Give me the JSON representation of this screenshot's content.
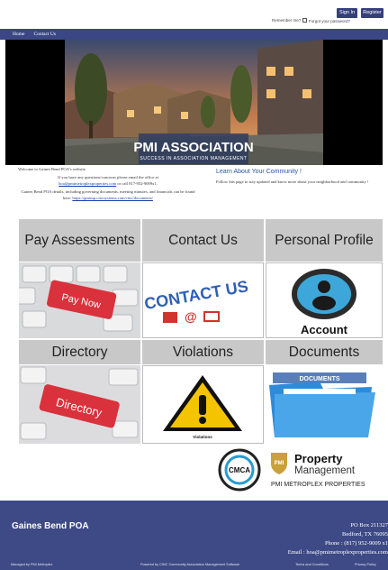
{
  "topbar": {
    "signin_label": "Sign In",
    "register_label": "Register",
    "remember_label": "Remember me?",
    "forgot_label": "Forgot your password?"
  },
  "nav": {
    "items": [
      {
        "label": "Home"
      },
      {
        "label": "Contact Us"
      }
    ]
  },
  "hero": {
    "title": "PMI ASSOCIATION",
    "subtitle": "SUCCESS IN ASSOCIATION MANAGEMENT"
  },
  "welcome": {
    "line1": "Welcome to Gaines Bend POA's website.",
    "line2": "If you have any questions/concerns please email the office at",
    "email": "hoa@pmimetroplexproperties.com",
    "line2b": "or call 817-952-9009x1.",
    "line3": "Gaines Bend POA details, including governing documents, meeting minutes, and financials can be found here:",
    "link": "https://gmimp.cincsystems.com/cinc/documents/"
  },
  "learn": {
    "title": "Learn About Your Community !",
    "text": "Follow this page to stay updated and know more about your neighborhood and community !"
  },
  "tiles": [
    {
      "label": "Pay Assessments",
      "image_text": "Pay Now"
    },
    {
      "label": "Contact Us",
      "image_text": "CONTACT US"
    },
    {
      "label": "Personal Profile",
      "image_text": "Account"
    },
    {
      "label": "Directory",
      "image_text": "Directory"
    },
    {
      "label": "Violations",
      "image_text": "Violations"
    },
    {
      "label": "Documents",
      "image_text": "DOCUMENTS"
    }
  ],
  "logos": {
    "cmca": "CMCA",
    "pmi_line1": "Property",
    "pmi_line2": "Management",
    "pmi_caption": "PMI METROPLEX PROPERTIES"
  },
  "footer": {
    "name": "Gaines Bend POA",
    "po_box": "PO Box 211327",
    "city": "Bedford, TX 76095",
    "phone": "Phone : (817) 952-9009 x1",
    "email": "Email : hoa@pmimetroplexproperties.com",
    "managed_by": "Managed by PMI Metroplex",
    "powered_by": "Powered by CINC Community Association Management Software",
    "terms": "Terms and Conditions",
    "privacy": "Privacy Policy"
  },
  "colors": {
    "nav": "#3a4784",
    "footer": "#3d4a86",
    "tile": "#c8c8c8",
    "link": "#2a55a8"
  }
}
